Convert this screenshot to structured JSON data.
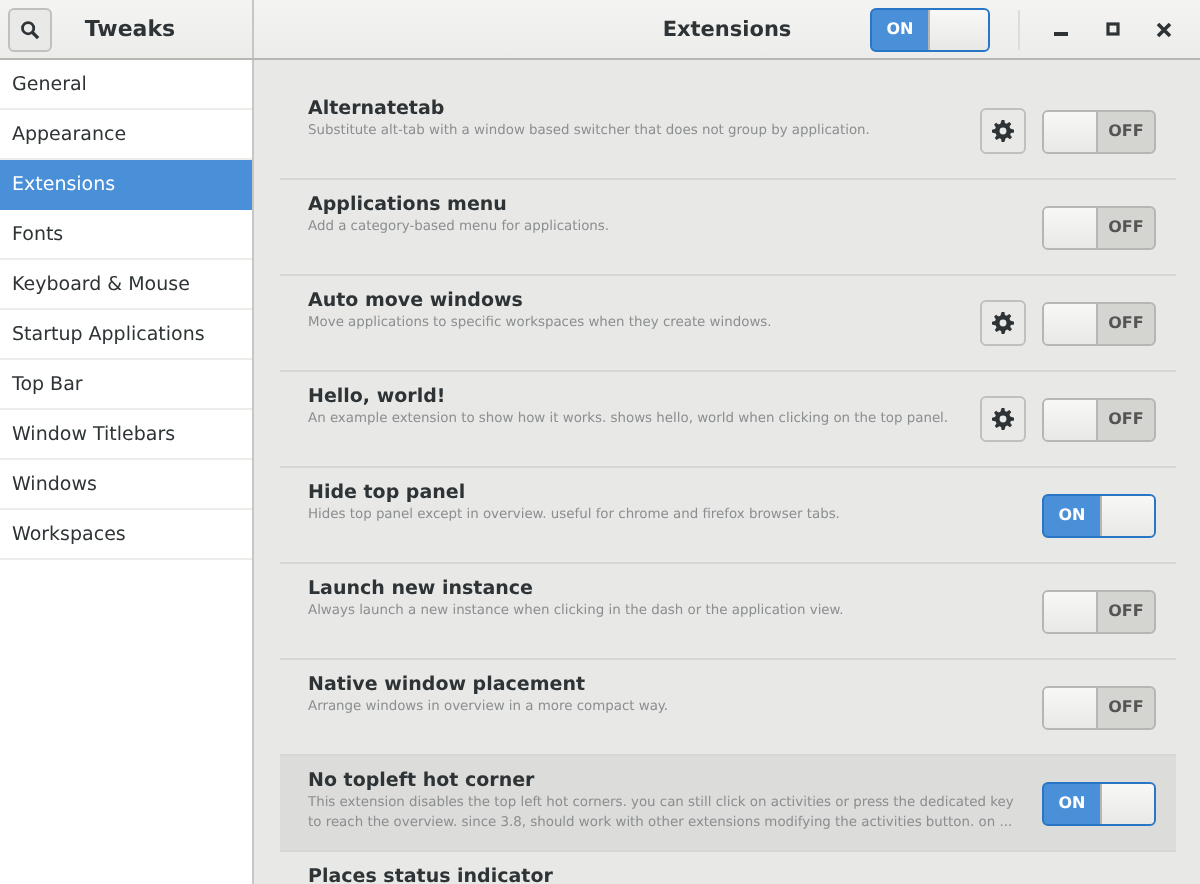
{
  "header": {
    "app_title": "Tweaks",
    "page_title": "Extensions",
    "global_switch": {
      "on": true,
      "label": "ON"
    }
  },
  "sidebar": {
    "items": [
      {
        "label": "General",
        "selected": false
      },
      {
        "label": "Appearance",
        "selected": false
      },
      {
        "label": "Extensions",
        "selected": true
      },
      {
        "label": "Fonts",
        "selected": false
      },
      {
        "label": "Keyboard & Mouse",
        "selected": false
      },
      {
        "label": "Startup Applications",
        "selected": false
      },
      {
        "label": "Top Bar",
        "selected": false
      },
      {
        "label": "Window Titlebars",
        "selected": false
      },
      {
        "label": "Windows",
        "selected": false
      },
      {
        "label": "Workspaces",
        "selected": false
      }
    ]
  },
  "extensions": [
    {
      "name": "Alternatetab",
      "description": "Substitute alt-tab with a window based switcher that does not group by application.",
      "has_settings": true,
      "on": false,
      "switch_label": "OFF",
      "highlighted": false
    },
    {
      "name": "Applications menu",
      "description": "Add a category-based menu for applications.",
      "has_settings": false,
      "on": false,
      "switch_label": "OFF",
      "highlighted": false
    },
    {
      "name": "Auto move windows",
      "description": "Move applications to specific workspaces when they create windows.",
      "has_settings": true,
      "on": false,
      "switch_label": "OFF",
      "highlighted": false
    },
    {
      "name": "Hello, world!",
      "description": "An example extension to show how it works. shows hello, world when clicking on the top panel.",
      "has_settings": true,
      "on": false,
      "switch_label": "OFF",
      "highlighted": false
    },
    {
      "name": "Hide top panel",
      "description": "Hides top panel except in overview. useful for chrome and firefox browser tabs.",
      "has_settings": false,
      "on": true,
      "switch_label": "ON",
      "highlighted": false
    },
    {
      "name": "Launch new instance",
      "description": "Always launch a new instance when clicking in the dash or the application view.",
      "has_settings": false,
      "on": false,
      "switch_label": "OFF",
      "highlighted": false
    },
    {
      "name": "Native window placement",
      "description": "Arrange windows in overview in a more compact way.",
      "has_settings": false,
      "on": false,
      "switch_label": "OFF",
      "highlighted": false
    },
    {
      "name": "No topleft hot corner",
      "description": "This extension disables the top left hot corners. you can still click on activities or press the dedicated key to reach the overview. since 3.8, should work with other extensions modifying the activities button. on ...",
      "has_settings": false,
      "on": true,
      "switch_label": "ON",
      "highlighted": true
    },
    {
      "name": "Places status indicator",
      "has_settings": false,
      "highlighted": false
    }
  ]
}
